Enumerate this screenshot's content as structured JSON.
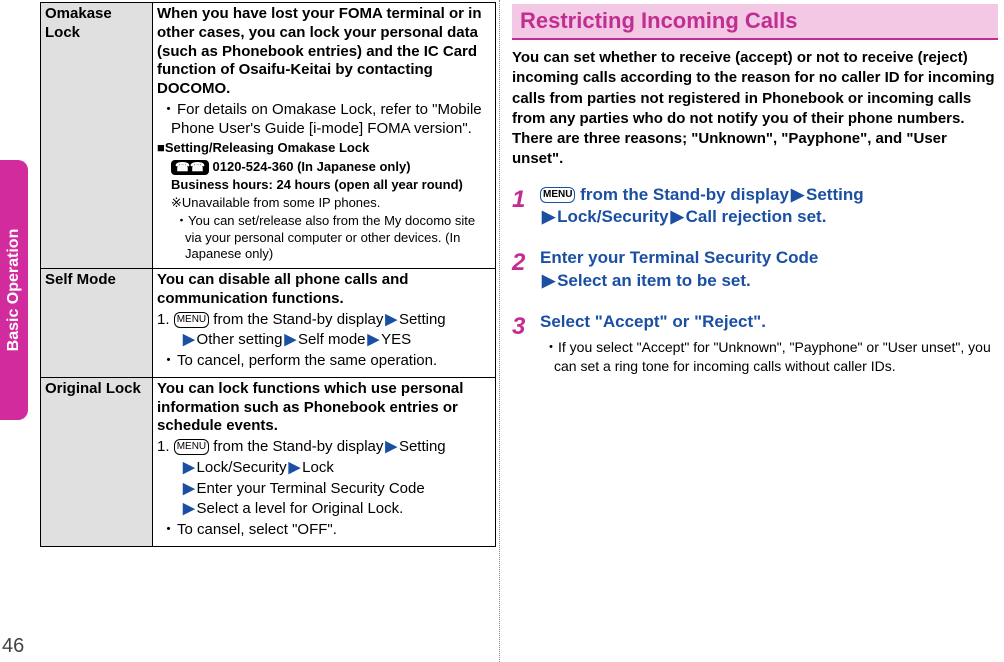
{
  "sidebar": {
    "label": "Basic Operation"
  },
  "page_number": "46",
  "table": {
    "rows": [
      {
        "name": "Omakase Lock",
        "heading": "When you have lost your FOMA terminal or in other cases, you can lock your personal data (such as Phonebook entries) and the IC Card function of Osaifu-Keitai by contacting DOCOMO.",
        "b1": "For details on Omakase Lock, refer to \"Mobile Phone User's Guide [i-mode] FOMA version\".",
        "sub_title": "■Setting/Releasing Omakase Lock",
        "phone_label": "0120-524-360 (In Japanese only)",
        "hours": "Business hours: 24 hours (open all year round)",
        "note1": "※Unavailable from some IP phones.",
        "note2": "You can set/release also from the My docomo site via your personal computer or other devices. (In Japanese only)"
      },
      {
        "name": "Self Mode",
        "heading": "You can disable all phone calls and communication functions.",
        "step_prefix": "1. ",
        "p1": " from the Stand-by display",
        "p2": "Setting",
        "p3": "Other setting",
        "p4": "Self mode",
        "p5": "YES",
        "b1": "To cancel, perform the same operation."
      },
      {
        "name": "Original Lock",
        "heading": "You can lock functions which use personal information such as Phonebook entries or schedule events.",
        "step_prefix": "1. ",
        "p1": " from the Stand-by display",
        "p2": "Setting",
        "p3": "Lock/Security",
        "p4": "Lock",
        "p5": "Enter your Terminal Security Code",
        "p6": "Select a level for Original Lock.",
        "b1": "To cansel, select \"OFF\"."
      }
    ]
  },
  "right": {
    "title": "Restricting Incoming Calls",
    "intro": "You can set whether to receive (accept) or not to receive (reject) incoming calls according to the reason for no caller ID for incoming calls from parties not registered in Phonebook or incoming calls from any parties who do not notify you of their phone numbers. There are three reasons; \"Unknown\", \"Payphone\", and \"User unset\".",
    "steps": [
      {
        "num": "1",
        "parts": [
          " from the Stand-by display",
          "Setting",
          "Lock/Security",
          "Call rejection set."
        ]
      },
      {
        "num": "2",
        "parts": [
          "Enter your Terminal Security Code",
          "Select an item to be set."
        ]
      },
      {
        "num": "3",
        "parts": [
          "Select \"Accept\" or \"Reject\"."
        ],
        "note": "If you select \"Accept\" for \"Unknown\", \"Payphone\" or \"User unset\", you can set a ring tone for incoming calls without caller IDs."
      }
    ]
  },
  "icons": {
    "menu": "MENU",
    "phone": "☎☎"
  }
}
